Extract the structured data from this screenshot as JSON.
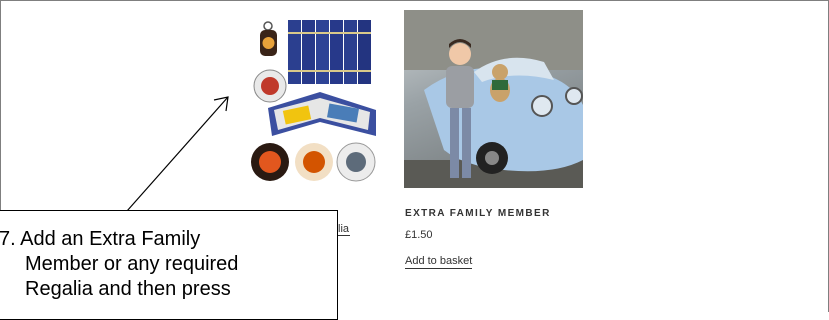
{
  "products": [
    {
      "name": "regalia-product",
      "image_icon": "regalia-collection-image",
      "link_fragment": "lia"
    },
    {
      "name": "extra-family-member",
      "image_icon": "boy-with-classic-car-photo",
      "title": "EXTRA FAMILY MEMBER",
      "price": "£1.50",
      "add_to_basket_label": "Add to basket"
    }
  ],
  "callout": {
    "line1": "7. Add an Extra Family",
    "line2": "Member or any required",
    "line3": "Regalia and then  press"
  },
  "colors": {
    "text": "#333333",
    "frame_border": "#7f7f7f",
    "car_blue": "#a9c8e6",
    "badge_red": "#c0392b",
    "book_blue": "#2b3f8f"
  }
}
